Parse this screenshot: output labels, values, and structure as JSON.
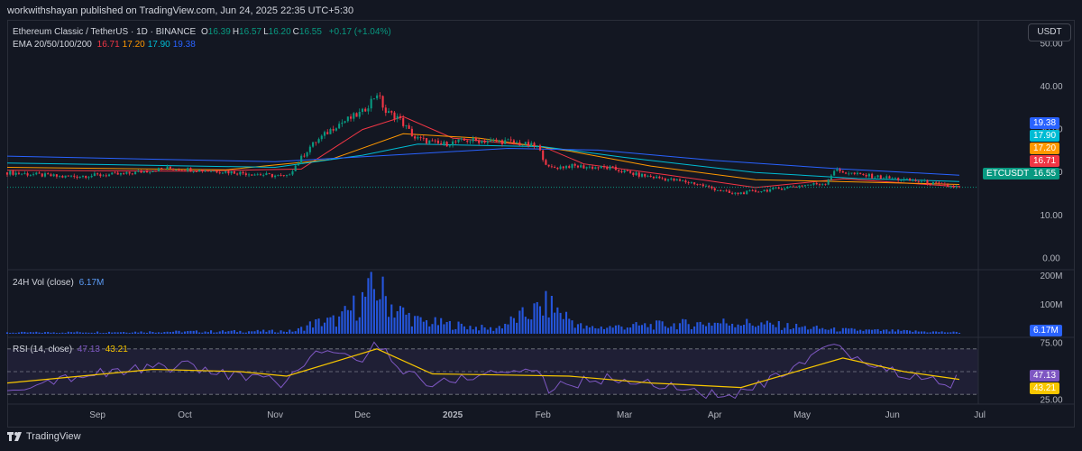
{
  "header": {
    "published": "workwithshayan published on TradingView.com, Jun 24, 2025 22:35 UTC+5:30"
  },
  "currency_button": "USDT",
  "legend": {
    "symbol": "Ethereum Classic / TetherUS · 1D · BINANCE",
    "ohlc": [
      {
        "key": "O",
        "value": "16.39"
      },
      {
        "key": "H",
        "value": "16.57"
      },
      {
        "key": "L",
        "value": "16.20"
      },
      {
        "key": "C",
        "value": "16.55"
      }
    ],
    "change": "+0.17 (+1.04%)",
    "ema_label": "EMA 20/50/100/200",
    "ema_values": [
      "16.71",
      "17.20",
      "17.90",
      "19.38"
    ],
    "vol_label": "24H Vol (close)",
    "vol_value": "6.17M",
    "rsi_label": "RSI (14, close)",
    "rsi_values": [
      "47.13",
      "43.21"
    ]
  },
  "price_tags": [
    {
      "text": "19.38",
      "color": "#2962ff"
    },
    {
      "text": "17.90",
      "color": "#00bcd4"
    },
    {
      "text": "17.20",
      "color": "#ff9800"
    },
    {
      "text": "16.71",
      "color": "#f23645"
    },
    {
      "text": "ETCUSDT",
      "color": "#089981"
    },
    {
      "text": "16.55",
      "color": "#089981"
    }
  ],
  "vol_tag": {
    "text": "6.17M",
    "color": "#2962ff"
  },
  "rsi_tags": [
    {
      "text": "47.13",
      "color": "#7e57c2"
    },
    {
      "text": "43.21",
      "color": "#f7c600"
    }
  ],
  "colors": {
    "up": "#089981",
    "down": "#f23645",
    "ema20": "#f23645",
    "ema50": "#ff9800",
    "ema100": "#00bcd4",
    "ema200": "#2962ff",
    "volume": "#2962ff",
    "rsi": "#7e57c2",
    "rsi_ma": "#f7c600"
  },
  "chart_data": [
    {
      "type": "candlestick",
      "x_ticks": [
        "Sep",
        "Oct",
        "Nov",
        "Dec",
        "2025",
        "Feb",
        "Mar",
        "Apr",
        "May",
        "Jun",
        "Jul"
      ],
      "y_ticks": [
        "50.00",
        "40.00",
        "30.00",
        "20.00",
        "10.00",
        "0.00"
      ],
      "ylim": [
        -2,
        53
      ],
      "grid": false,
      "close_path": [
        {
          "x": "2024-08-01",
          "y": 20
        },
        {
          "x": "2024-08-20",
          "y": 19
        },
        {
          "x": "2024-09-10",
          "y": 19.6
        },
        {
          "x": "2024-09-25",
          "y": 21
        },
        {
          "x": "2024-10-15",
          "y": 20.2
        },
        {
          "x": "2024-11-05",
          "y": 19
        },
        {
          "x": "2024-11-13",
          "y": 26
        },
        {
          "x": "2024-11-22",
          "y": 31
        },
        {
          "x": "2024-12-01",
          "y": 34
        },
        {
          "x": "2024-12-06",
          "y": 38.5
        },
        {
          "x": "2024-12-09",
          "y": 34
        },
        {
          "x": "2024-12-13",
          "y": 33
        },
        {
          "x": "2024-12-19",
          "y": 28
        },
        {
          "x": "2024-12-28",
          "y": 26.5
        },
        {
          "x": "2025-01-06",
          "y": 27.5
        },
        {
          "x": "2025-01-20",
          "y": 27.2
        },
        {
          "x": "2025-01-30",
          "y": 26
        },
        {
          "x": "2025-02-03",
          "y": 21
        },
        {
          "x": "2025-02-10",
          "y": 21.5
        },
        {
          "x": "2025-02-24",
          "y": 21
        },
        {
          "x": "2025-03-05",
          "y": 19.5
        },
        {
          "x": "2025-03-25",
          "y": 17.5
        },
        {
          "x": "2025-04-07",
          "y": 15
        },
        {
          "x": "2025-04-20",
          "y": 16
        },
        {
          "x": "2025-05-01",
          "y": 17
        },
        {
          "x": "2025-05-09",
          "y": 17.5
        },
        {
          "x": "2025-05-12",
          "y": 20.5
        },
        {
          "x": "2025-05-20",
          "y": 19.5
        },
        {
          "x": "2025-06-01",
          "y": 18.6
        },
        {
          "x": "2025-06-12",
          "y": 17.8
        },
        {
          "x": "2025-06-20",
          "y": 16.8
        },
        {
          "x": "2025-06-24",
          "y": 16.55
        }
      ],
      "ema_series": [
        {
          "name": "EMA 20",
          "color": "#f23645",
          "points": [
            {
              "x": "2024-08-01",
              "y": 20.5
            },
            {
              "x": "2024-10-01",
              "y": 20.3
            },
            {
              "x": "2024-11-10",
              "y": 20.8
            },
            {
              "x": "2024-12-01",
              "y": 30
            },
            {
              "x": "2024-12-15",
              "y": 33
            },
            {
              "x": "2025-01-01",
              "y": 28
            },
            {
              "x": "2025-02-01",
              "y": 26
            },
            {
              "x": "2025-02-15",
              "y": 22
            },
            {
              "x": "2025-03-15",
              "y": 19.5
            },
            {
              "x": "2025-04-15",
              "y": 16.5
            },
            {
              "x": "2025-05-15",
              "y": 18.5
            },
            {
              "x": "2025-06-24",
              "y": 16.71
            }
          ]
        },
        {
          "name": "EMA 50",
          "color": "#ff9800",
          "points": [
            {
              "x": "2024-08-01",
              "y": 21.2
            },
            {
              "x": "2024-10-15",
              "y": 20.6
            },
            {
              "x": "2024-11-20",
              "y": 23
            },
            {
              "x": "2024-12-15",
              "y": 29
            },
            {
              "x": "2025-01-10",
              "y": 28
            },
            {
              "x": "2025-02-10",
              "y": 25
            },
            {
              "x": "2025-03-10",
              "y": 21.5
            },
            {
              "x": "2025-04-15",
              "y": 18.3
            },
            {
              "x": "2025-05-20",
              "y": 17.8
            },
            {
              "x": "2025-06-24",
              "y": 17.2
            }
          ]
        },
        {
          "name": "EMA 100",
          "color": "#00bcd4",
          "points": [
            {
              "x": "2024-08-01",
              "y": 22.2
            },
            {
              "x": "2024-11-01",
              "y": 21.2
            },
            {
              "x": "2024-12-01",
              "y": 24
            },
            {
              "x": "2024-12-20",
              "y": 26.6
            },
            {
              "x": "2025-02-01",
              "y": 26
            },
            {
              "x": "2025-03-01",
              "y": 23.5
            },
            {
              "x": "2025-04-15",
              "y": 20
            },
            {
              "x": "2025-05-20",
              "y": 18.6
            },
            {
              "x": "2025-06-24",
              "y": 17.9
            }
          ]
        },
        {
          "name": "EMA 200",
          "color": "#2962ff",
          "points": [
            {
              "x": "2024-08-01",
              "y": 23.8
            },
            {
              "x": "2024-11-01",
              "y": 22.5
            },
            {
              "x": "2024-12-15",
              "y": 24.2
            },
            {
              "x": "2025-01-20",
              "y": 25.6
            },
            {
              "x": "2025-02-20",
              "y": 25.2
            },
            {
              "x": "2025-04-01",
              "y": 22.8
            },
            {
              "x": "2025-05-15",
              "y": 20.8
            },
            {
              "x": "2025-06-24",
              "y": 19.38
            }
          ]
        }
      ]
    },
    {
      "type": "bar",
      "title": "24H Vol (close)",
      "y_ticks": [
        "200M",
        "100M"
      ],
      "ylim": [
        0,
        210
      ],
      "peaks": [
        {
          "x": "2024-08-01",
          "y": 5
        },
        {
          "x": "2024-11-08",
          "y": 12
        },
        {
          "x": "2024-11-14",
          "y": 45
        },
        {
          "x": "2024-11-23",
          "y": 60
        },
        {
          "x": "2024-12-06",
          "y": 200
        },
        {
          "x": "2024-12-12",
          "y": 110
        },
        {
          "x": "2024-12-20",
          "y": 55
        },
        {
          "x": "2025-01-15",
          "y": 20
        },
        {
          "x": "2025-02-03",
          "y": 125
        },
        {
          "x": "2025-02-15",
          "y": 25
        },
        {
          "x": "2025-04-07",
          "y": 50
        },
        {
          "x": "2025-05-12",
          "y": 18
        },
        {
          "x": "2025-06-24",
          "y": 6
        }
      ]
    },
    {
      "type": "line",
      "title": "RSI (14, close)",
      "y_ticks": [
        "75.00",
        "25.00"
      ],
      "ylim": [
        23,
        77
      ],
      "bands": [
        70,
        50,
        30
      ],
      "rsi_path": [
        {
          "x": "2024-08-01",
          "y": 36
        },
        {
          "x": "2024-08-20",
          "y": 45
        },
        {
          "x": "2024-09-15",
          "y": 52
        },
        {
          "x": "2024-10-01",
          "y": 55
        },
        {
          "x": "2024-10-20",
          "y": 46
        },
        {
          "x": "2024-11-05",
          "y": 40
        },
        {
          "x": "2024-11-15",
          "y": 68
        },
        {
          "x": "2024-12-01",
          "y": 60
        },
        {
          "x": "2024-12-06",
          "y": 76
        },
        {
          "x": "2024-12-15",
          "y": 52
        },
        {
          "x": "2024-12-25",
          "y": 38
        },
        {
          "x": "2025-01-10",
          "y": 48
        },
        {
          "x": "2025-01-30",
          "y": 52
        },
        {
          "x": "2025-02-03",
          "y": 35
        },
        {
          "x": "2025-02-20",
          "y": 44
        },
        {
          "x": "2025-03-10",
          "y": 40
        },
        {
          "x": "2025-04-07",
          "y": 27
        },
        {
          "x": "2025-04-25",
          "y": 48
        },
        {
          "x": "2025-05-12",
          "y": 72
        },
        {
          "x": "2025-05-25",
          "y": 55
        },
        {
          "x": "2025-06-10",
          "y": 45
        },
        {
          "x": "2025-06-20",
          "y": 38
        },
        {
          "x": "2025-06-24",
          "y": 47.13
        }
      ],
      "ma_path": [
        {
          "x": "2024-08-01",
          "y": 40
        },
        {
          "x": "2024-09-20",
          "y": 52
        },
        {
          "x": "2024-10-20",
          "y": 50
        },
        {
          "x": "2024-11-05",
          "y": 46
        },
        {
          "x": "2024-12-06",
          "y": 70
        },
        {
          "x": "2024-12-25",
          "y": 48
        },
        {
          "x": "2025-01-20",
          "y": 47
        },
        {
          "x": "2025-02-10",
          "y": 46
        },
        {
          "x": "2025-03-10",
          "y": 40
        },
        {
          "x": "2025-04-10",
          "y": 36
        },
        {
          "x": "2025-05-15",
          "y": 62
        },
        {
          "x": "2025-06-05",
          "y": 50
        },
        {
          "x": "2025-06-24",
          "y": 43.21
        }
      ]
    }
  ]
}
